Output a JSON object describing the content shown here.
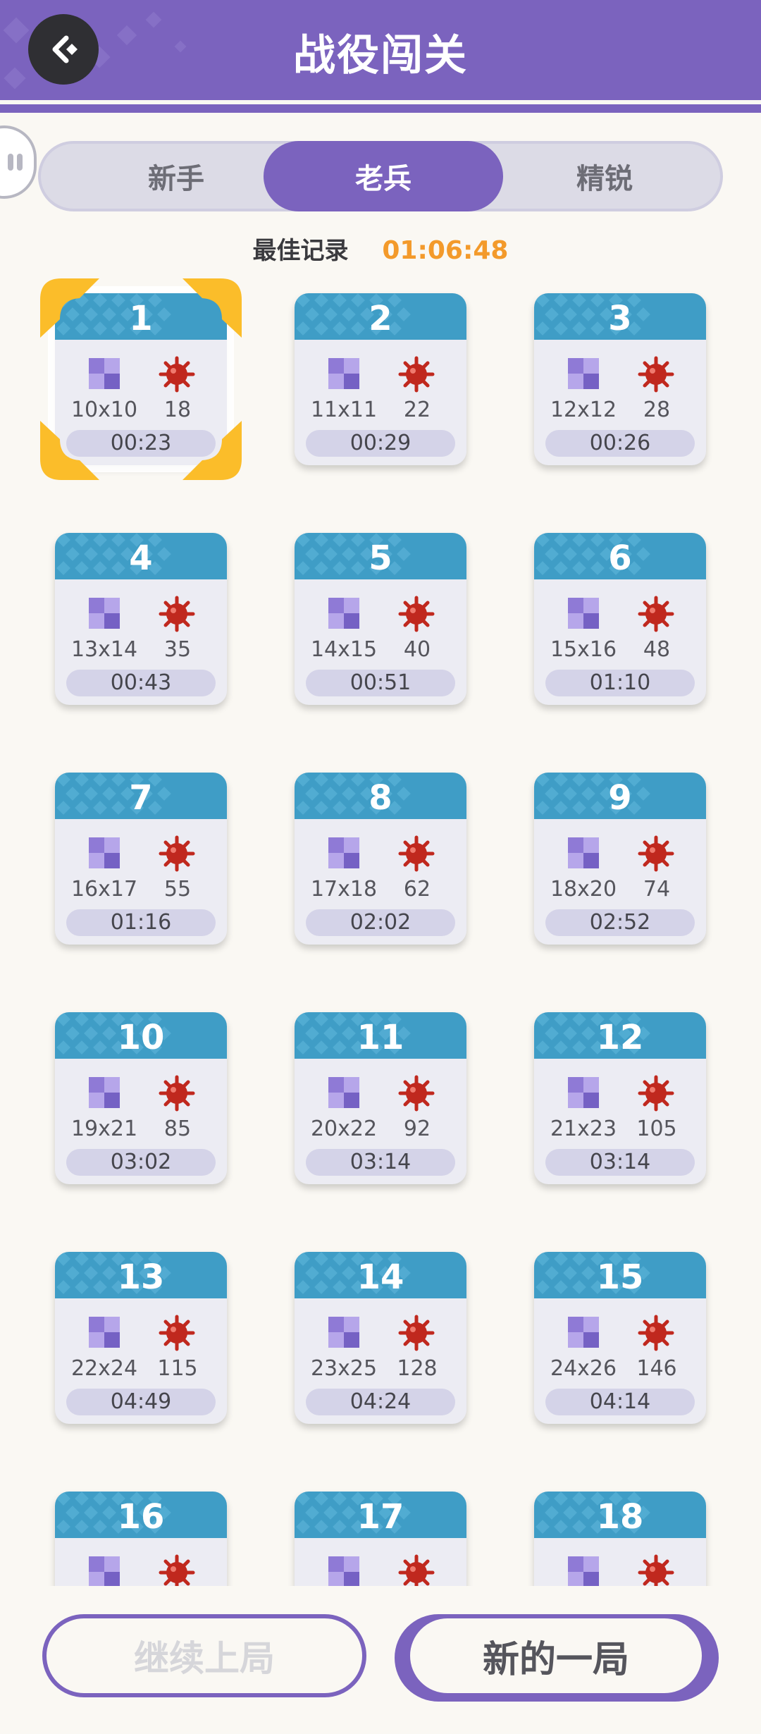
{
  "header": {
    "title": "战役闯关",
    "back_icon": "back-arrow-icon",
    "color": "#7b63be"
  },
  "tabs": [
    {
      "label": "新手",
      "active": false
    },
    {
      "label": "老兵",
      "active": true
    },
    {
      "label": "精锐",
      "active": false
    }
  ],
  "best_record": {
    "label": "最佳记录",
    "value": "01:06:48"
  },
  "levels": [
    {
      "number": "1",
      "size": "10x10",
      "mines": "18",
      "time": "00:23",
      "selected": true
    },
    {
      "number": "2",
      "size": "11x11",
      "mines": "22",
      "time": "00:29"
    },
    {
      "number": "3",
      "size": "12x12",
      "mines": "28",
      "time": "00:26"
    },
    {
      "number": "4",
      "size": "13x14",
      "mines": "35",
      "time": "00:43"
    },
    {
      "number": "5",
      "size": "14x15",
      "mines": "40",
      "time": "00:51"
    },
    {
      "number": "6",
      "size": "15x16",
      "mines": "48",
      "time": "01:10"
    },
    {
      "number": "7",
      "size": "16x17",
      "mines": "55",
      "time": "01:16"
    },
    {
      "number": "8",
      "size": "17x18",
      "mines": "62",
      "time": "02:02"
    },
    {
      "number": "9",
      "size": "18x20",
      "mines": "74",
      "time": "02:52"
    },
    {
      "number": "10",
      "size": "19x21",
      "mines": "85",
      "time": "03:02"
    },
    {
      "number": "11",
      "size": "20x22",
      "mines": "92",
      "time": "03:14"
    },
    {
      "number": "12",
      "size": "21x23",
      "mines": "105",
      "time": "03:14"
    },
    {
      "number": "13",
      "size": "22x24",
      "mines": "115",
      "time": "04:49"
    },
    {
      "number": "14",
      "size": "23x25",
      "mines": "128",
      "time": "04:24"
    },
    {
      "number": "15",
      "size": "24x26",
      "mines": "146",
      "time": "04:14"
    },
    {
      "number": "16",
      "size": "",
      "mines": "",
      "time": ""
    },
    {
      "number": "17",
      "size": "",
      "mines": "",
      "time": ""
    },
    {
      "number": "18",
      "size": "",
      "mines": "",
      "time": ""
    }
  ],
  "buttons": {
    "continue_label": "继续上局",
    "new_label": "新的一局"
  },
  "colors": {
    "accent": "#7b63be",
    "card_header": "#3f9dc6",
    "best_value": "#f39a2b",
    "mine": "#c0281e",
    "selection": "#fbbd2a"
  }
}
